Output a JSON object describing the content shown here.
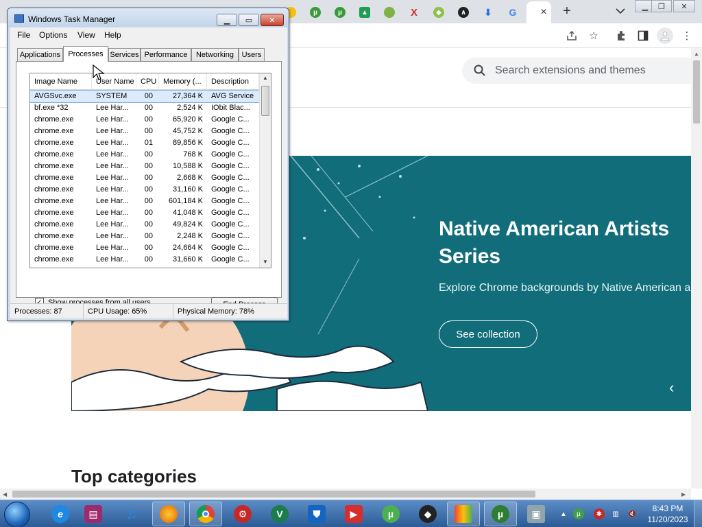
{
  "browser": {
    "new_tab_label": "+",
    "tab_search_label": "⌄",
    "active_tab_close": "×",
    "search_placeholder": "Search extensions and themes",
    "banner": {
      "title": "Native American Artists Series",
      "subtitle": "Explore Chrome backgrounds by Native American a",
      "button_label": "See collection",
      "prev_label": "‹",
      "bg_color": "#126d7b"
    },
    "section_title": "Top categories"
  },
  "task_manager": {
    "title": "Windows Task Manager",
    "menu": [
      "File",
      "Options",
      "View",
      "Help"
    ],
    "tabs": [
      "Applications",
      "Processes",
      "Services",
      "Performance",
      "Networking",
      "Users"
    ],
    "active_tab": "Processes",
    "columns": [
      "Image Name",
      "User Name",
      "CPU",
      "Memory (...",
      "Description"
    ],
    "rows": [
      [
        "AVGSvc.exe",
        "SYSTEM",
        "00",
        "27,364 K",
        "AVG Service"
      ],
      [
        "bf.exe *32",
        "Lee Har...",
        "00",
        "2,524 K",
        "IObit Blac..."
      ],
      [
        "chrome.exe",
        "Lee Har...",
        "00",
        "65,920 K",
        "Google C..."
      ],
      [
        "chrome.exe",
        "Lee Har...",
        "00",
        "45,752 K",
        "Google C..."
      ],
      [
        "chrome.exe",
        "Lee Har...",
        "01",
        "89,856 K",
        "Google C..."
      ],
      [
        "chrome.exe",
        "Lee Har...",
        "00",
        "768 K",
        "Google C..."
      ],
      [
        "chrome.exe",
        "Lee Har...",
        "00",
        "10,588 K",
        "Google C..."
      ],
      [
        "chrome.exe",
        "Lee Har...",
        "00",
        "2,668 K",
        "Google C..."
      ],
      [
        "chrome.exe",
        "Lee Har...",
        "00",
        "31,160 K",
        "Google C..."
      ],
      [
        "chrome.exe",
        "Lee Har...",
        "00",
        "601,184 K",
        "Google C..."
      ],
      [
        "chrome.exe",
        "Lee Har...",
        "00",
        "41,048 K",
        "Google C..."
      ],
      [
        "chrome.exe",
        "Lee Har...",
        "00",
        "49,824 K",
        "Google C..."
      ],
      [
        "chrome.exe",
        "Lee Har...",
        "00",
        "2,248 K",
        "Google C..."
      ],
      [
        "chrome.exe",
        "Lee Har...",
        "00",
        "24,664 K",
        "Google C..."
      ],
      [
        "chrome.exe",
        "Lee Har...",
        "00",
        "31,660 K",
        "Google C..."
      ]
    ],
    "show_all_label": "Show processes from all users",
    "show_all_checked": true,
    "end_process_label": "End Process",
    "status": {
      "processes": "Processes: 87",
      "cpu": "CPU Usage: 65%",
      "memory": "Physical Memory: 78%"
    }
  },
  "taskbar": {
    "time": "8:43 PM",
    "date": "11/20/2023"
  }
}
